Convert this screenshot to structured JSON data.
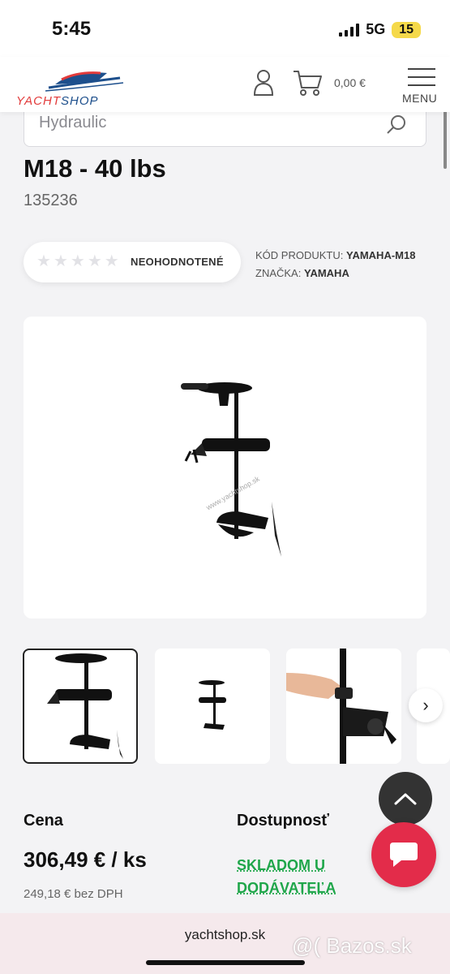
{
  "status_bar": {
    "time": "5:45",
    "network": "5G",
    "battery": "15"
  },
  "header": {
    "logo_left": "YACHT",
    "logo_right": "SHOP",
    "cart_total": "0,00 €",
    "menu_label": "MENU"
  },
  "search": {
    "placeholder": "Hydraulic"
  },
  "product": {
    "title": "M18 - 40 lbs",
    "sku": "135236",
    "rating_label": "NEOHODNOTENÉ",
    "rating_stars": 0,
    "code_label": "KÓD PRODUKTU:",
    "code_value": "YAMAHA-M18",
    "brand_label": "ZNAČKA:",
    "brand_value": "YAMAHA",
    "image_watermark": "www.yachtshop.sk"
  },
  "pricing": {
    "price_label": "Cena",
    "price": "306,49 € / ks",
    "price_no_vat": "249,18 € bez DPH",
    "availability_label": "Dostupnosť",
    "availability": "SKLADOM U DODÁVATEĽA"
  },
  "browser": {
    "url": "yachtshop.sk"
  },
  "watermark": "@( Bazos.sk",
  "colors": {
    "accent": "#e32c4a",
    "available": "#1fa64a",
    "logo_red": "#e23b3b",
    "logo_blue": "#1d4f8c"
  }
}
